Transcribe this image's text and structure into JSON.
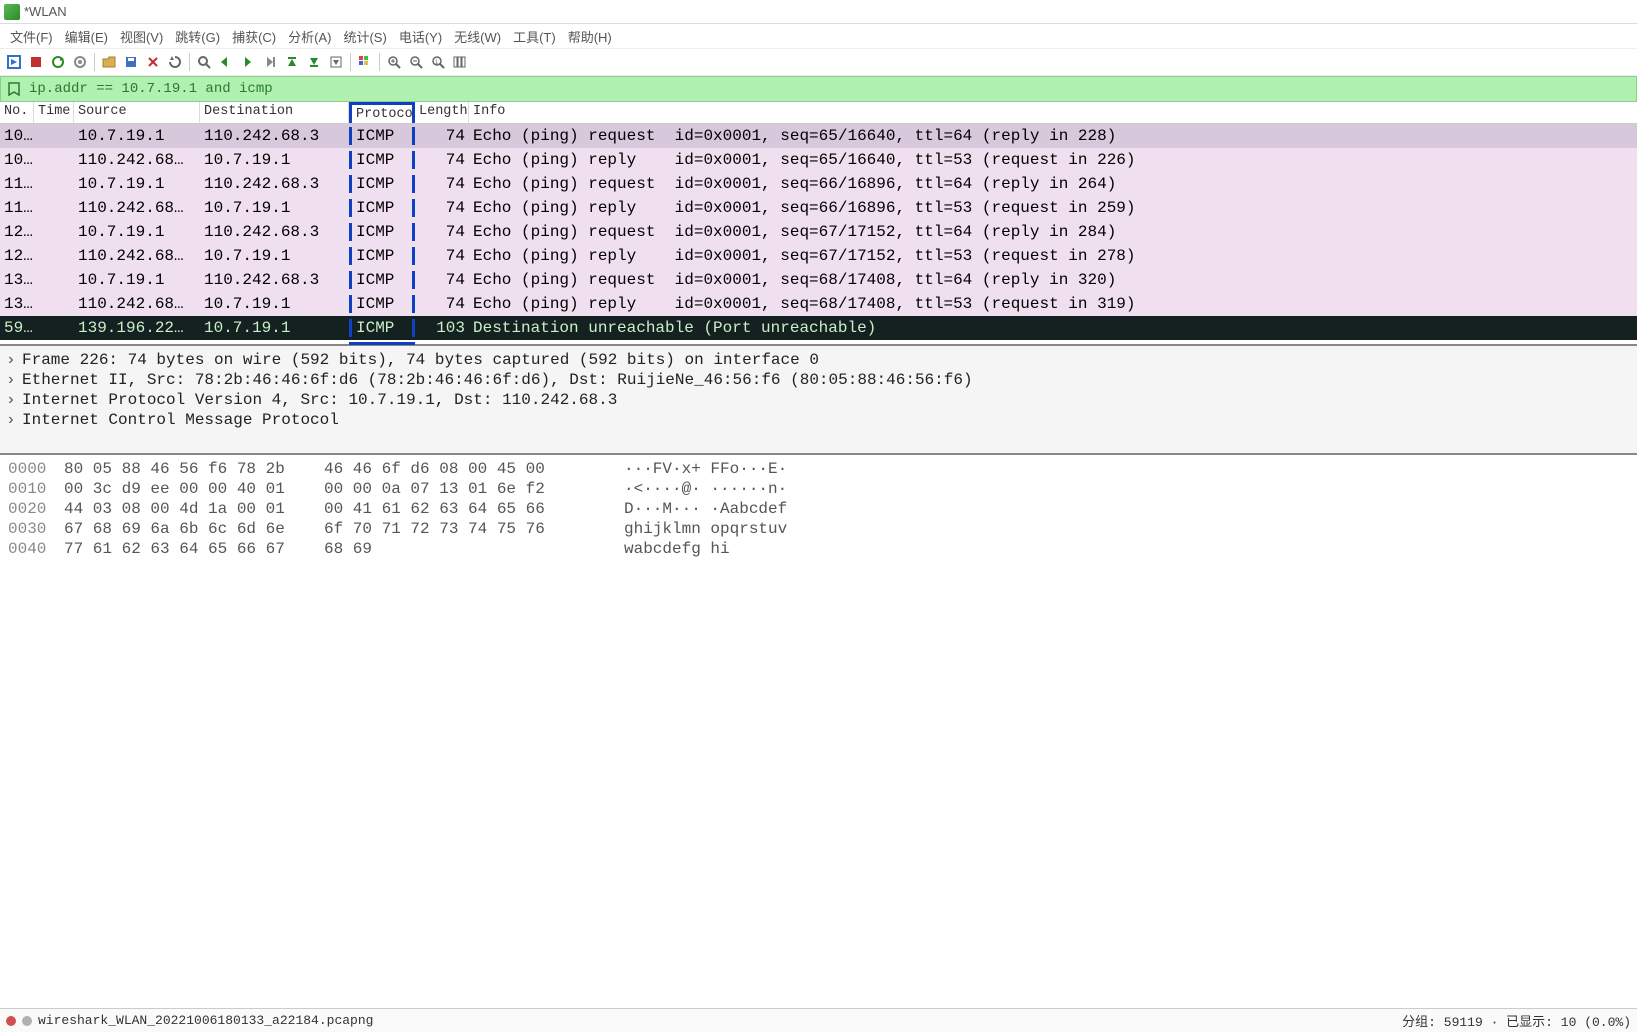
{
  "title": "*WLAN",
  "menu": [
    "文件(F)",
    "编辑(E)",
    "视图(V)",
    "跳转(G)",
    "捕获(C)",
    "分析(A)",
    "统计(S)",
    "电话(Y)",
    "无线(W)",
    "工具(T)",
    "帮助(H)"
  ],
  "filter": {
    "text": "ip.addr == 10.7.19.1 and icmp"
  },
  "columns": {
    "no": "No.",
    "time": "Time",
    "source": "Source",
    "destination": "Destination",
    "protocol": "Protocol",
    "length": "Length",
    "info": "Info"
  },
  "packets": [
    {
      "no": "10…",
      "time": "",
      "src": "10.7.19.1",
      "dst": "110.242.68.3",
      "proto": "ICMP",
      "len": "74",
      "info": "Echo (ping) request  id=0x0001, seq=65/16640, ttl=64 (reply in 228)",
      "cls": "row-icmp-sel",
      "ind": "→"
    },
    {
      "no": "10…",
      "time": "",
      "src": "110.242.68…",
      "dst": "10.7.19.1",
      "proto": "ICMP",
      "len": "74",
      "info": "Echo (ping) reply    id=0x0001, seq=65/16640, ttl=53 (request in 226)",
      "cls": "row-icmp",
      "ind": "←"
    },
    {
      "no": "11…",
      "time": "",
      "src": "10.7.19.1",
      "dst": "110.242.68.3",
      "proto": "ICMP",
      "len": "74",
      "info": "Echo (ping) request  id=0x0001, seq=66/16896, ttl=64 (reply in 264)",
      "cls": "row-icmp",
      "ind": ""
    },
    {
      "no": "11…",
      "time": "",
      "src": "110.242.68…",
      "dst": "10.7.19.1",
      "proto": "ICMP",
      "len": "74",
      "info": "Echo (ping) reply    id=0x0001, seq=66/16896, ttl=53 (request in 259)",
      "cls": "row-icmp",
      "ind": ""
    },
    {
      "no": "12…",
      "time": "",
      "src": "10.7.19.1",
      "dst": "110.242.68.3",
      "proto": "ICMP",
      "len": "74",
      "info": "Echo (ping) request  id=0x0001, seq=67/17152, ttl=64 (reply in 284)",
      "cls": "row-icmp",
      "ind": ""
    },
    {
      "no": "12…",
      "time": "",
      "src": "110.242.68…",
      "dst": "10.7.19.1",
      "proto": "ICMP",
      "len": "74",
      "info": "Echo (ping) reply    id=0x0001, seq=67/17152, ttl=53 (request in 278)",
      "cls": "row-icmp",
      "ind": ""
    },
    {
      "no": "13…",
      "time": "",
      "src": "10.7.19.1",
      "dst": "110.242.68.3",
      "proto": "ICMP",
      "len": "74",
      "info": "Echo (ping) request  id=0x0001, seq=68/17408, ttl=64 (reply in 320)",
      "cls": "row-icmp",
      "ind": ""
    },
    {
      "no": "13…",
      "time": "",
      "src": "110.242.68…",
      "dst": "10.7.19.1",
      "proto": "ICMP",
      "len": "74",
      "info": "Echo (ping) reply    id=0x0001, seq=68/17408, ttl=53 (request in 319)",
      "cls": "row-icmp",
      "ind": "└"
    },
    {
      "no": "59…",
      "time": "",
      "src": "139.196.22…",
      "dst": "10.7.19.1",
      "proto": "ICMP",
      "len": "103",
      "info": "Destination unreachable (Port unreachable)",
      "cls": "row-dark",
      "ind": ""
    }
  ],
  "details": [
    "Frame 226: 74 bytes on wire (592 bits), 74 bytes captured (592 bits) on interface 0",
    "Ethernet II, Src: 78:2b:46:46:6f:d6 (78:2b:46:46:6f:d6), Dst: RuijieNe_46:56:f6 (80:05:88:46:56:f6)",
    "Internet Protocol Version 4, Src: 10.7.19.1, Dst: 110.242.68.3",
    "Internet Control Message Protocol"
  ],
  "hex": [
    {
      "off": "0000",
      "b1": "80 05 88 46 56 f6 78 2b",
      "b2": "46 46 6f d6 08 00 45 00",
      "asc": "···FV·x+ FFo···E·"
    },
    {
      "off": "0010",
      "b1": "00 3c d9 ee 00 00 40 01",
      "b2": "00 00 0a 07 13 01 6e f2",
      "asc": "·<····@· ······n·"
    },
    {
      "off": "0020",
      "b1": "44 03 08 00 4d 1a 00 01",
      "b2": "00 41 61 62 63 64 65 66",
      "asc": "D···M··· ·Aabcdef"
    },
    {
      "off": "0030",
      "b1": "67 68 69 6a 6b 6c 6d 6e",
      "b2": "6f 70 71 72 73 74 75 76",
      "asc": "ghijklmn opqrstuv"
    },
    {
      "off": "0040",
      "b1": "77 61 62 63 64 65 66 67",
      "b2": "68 69",
      "asc": "wabcdefg hi"
    }
  ],
  "status": {
    "file": "wireshark_WLAN_20221006180133_a22184.pcapng",
    "right": "分组: 59119 · 已显示: 10 (0.0%)"
  }
}
